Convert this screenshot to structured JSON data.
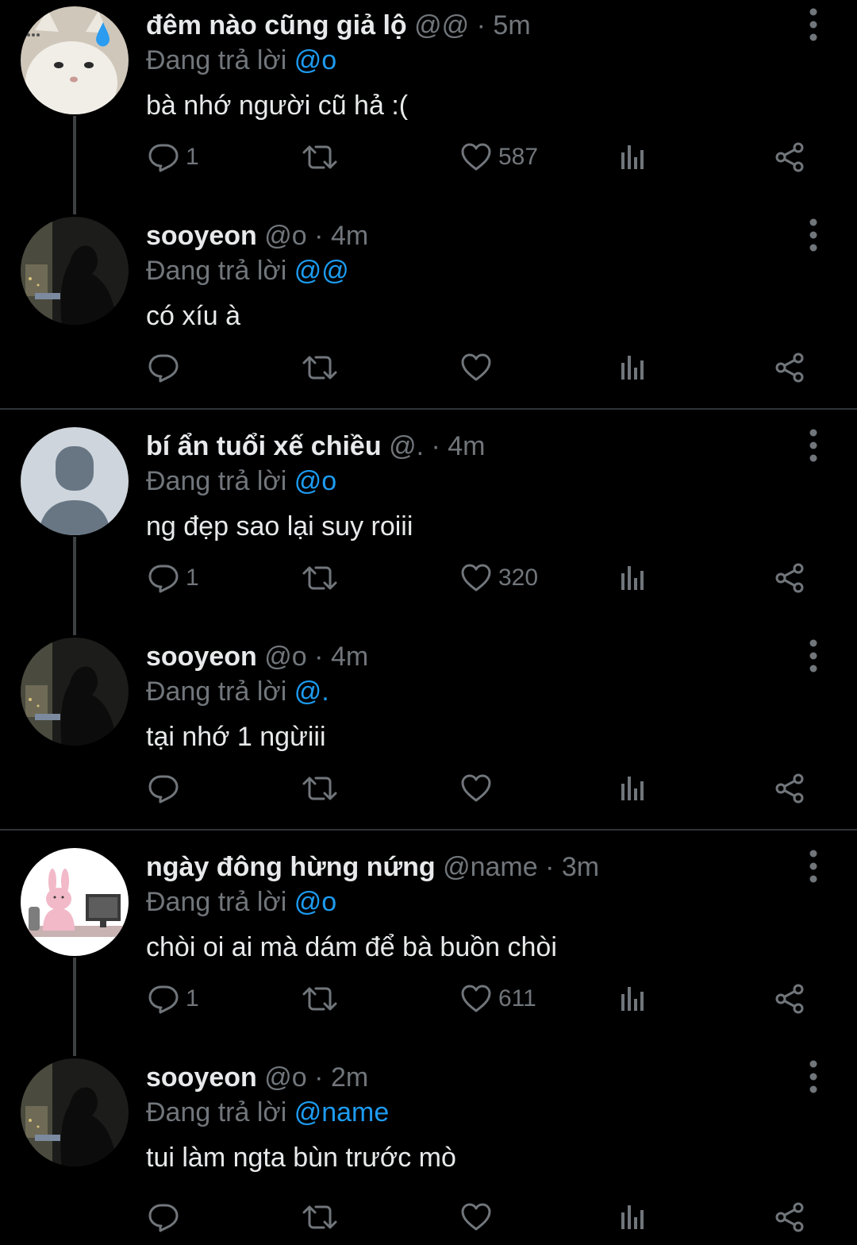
{
  "replying_prefix": "Đang trả lời",
  "tweets": [
    {
      "name": "đêm nào cũng giả lộ",
      "handle": "@@",
      "dot": "·",
      "time": "5m",
      "replying_to": "@o",
      "text": "bà nhớ người cũ hả :(",
      "reply_count": "1",
      "like_count": "587"
    },
    {
      "name": "sooyeon",
      "handle": "@o",
      "dot": "·",
      "time": "4m",
      "replying_to": "@@",
      "text": "có xíu à",
      "reply_count": "",
      "like_count": ""
    },
    {
      "name": "bí ẩn tuổi xế chiều",
      "handle": "@.",
      "dot": "·",
      "time": "4m",
      "replying_to": "@o",
      "text": "ng đẹp sao lại suy roiii",
      "reply_count": "1",
      "like_count": "320"
    },
    {
      "name": "sooyeon",
      "handle": "@o",
      "dot": "·",
      "time": "4m",
      "replying_to": "@.",
      "text": "tại nhớ 1 ngừiii",
      "reply_count": "",
      "like_count": ""
    },
    {
      "name": "ngày đông hừng nứng",
      "handle": "@name",
      "dot": "·",
      "time": "3m",
      "replying_to": "@o",
      "text": "chòi oi ai mà dám để bà buồn chòi",
      "reply_count": "1",
      "like_count": "611"
    },
    {
      "name": "sooyeon",
      "handle": "@o",
      "dot": "·",
      "time": "2m",
      "replying_to": "@name",
      "text": "tui làm ngta bùn trước mò",
      "reply_count": "",
      "like_count": ""
    }
  ],
  "colors": {
    "background": "#000000",
    "text": "#e7e9ea",
    "muted": "#71767b",
    "accent": "#1d9bf0",
    "divider": "#2f3336"
  },
  "icons": {
    "more": "more-vertical-icon",
    "reply": "reply-icon",
    "retweet": "retweet-icon",
    "like": "heart-icon",
    "views": "analytics-icon",
    "share": "share-icon"
  }
}
